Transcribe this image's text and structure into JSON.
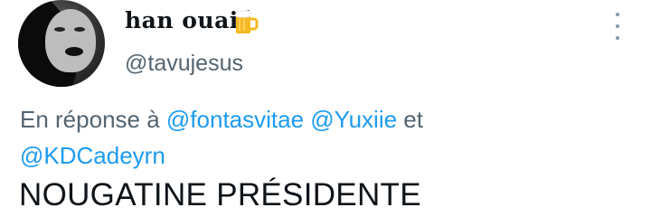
{
  "author": {
    "display_name": "han ouaiś",
    "emoji_icon": "beer-mug-icon",
    "username": "@tavujesus"
  },
  "reply": {
    "prefix": "En réponse à",
    "mentions": [
      "@fontasvitae",
      "@Yuxiie",
      "@KDCadeyrn"
    ],
    "conjunction": "et"
  },
  "tweet": {
    "text": "NOUGATINE PRÉSIDENTE"
  },
  "colors": {
    "mention": "#1d9bf0",
    "secondary": "#536471",
    "primary": "#0f1419"
  }
}
